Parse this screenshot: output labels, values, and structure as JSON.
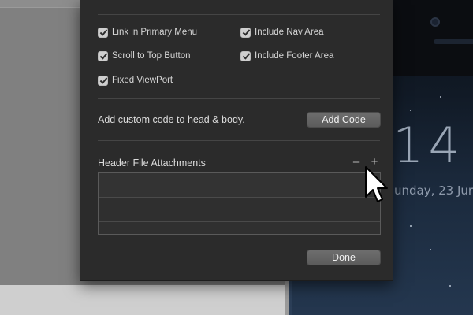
{
  "options": [
    {
      "label": "Link in Primary Menu",
      "checked": true
    },
    {
      "label": "Include Nav Area",
      "checked": true
    },
    {
      "label": "Scroll to Top Button",
      "checked": true
    },
    {
      "label": "Include Footer Area",
      "checked": true
    },
    {
      "label": "Fixed ViewPort",
      "checked": true
    }
  ],
  "custom_code": {
    "label": "Add custom code to head & body.",
    "button_label": "Add Code"
  },
  "attachments": {
    "label": "Header File Attachments",
    "remove_symbol": "–",
    "add_symbol": "+",
    "rows": [
      "",
      ""
    ]
  },
  "done_label": "Done",
  "preview": {
    "clock": "14",
    "date": "unday, 23 Jur"
  }
}
